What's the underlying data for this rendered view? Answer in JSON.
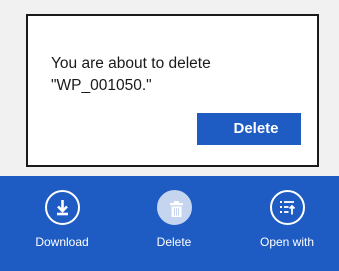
{
  "dialog": {
    "message": "You are about to delete \"WP_001050.\"",
    "confirm_label": "Delete"
  },
  "app_bar": {
    "commands": [
      {
        "label": "Download",
        "icon": "download-icon"
      },
      {
        "label": "Delete",
        "icon": "trash-icon"
      },
      {
        "label": "Open with",
        "icon": "open-with-icon"
      }
    ]
  },
  "colors": {
    "accent": "#1e5bc2",
    "background": "#f1f1f1",
    "selected_circle": "#c5d5f0"
  }
}
